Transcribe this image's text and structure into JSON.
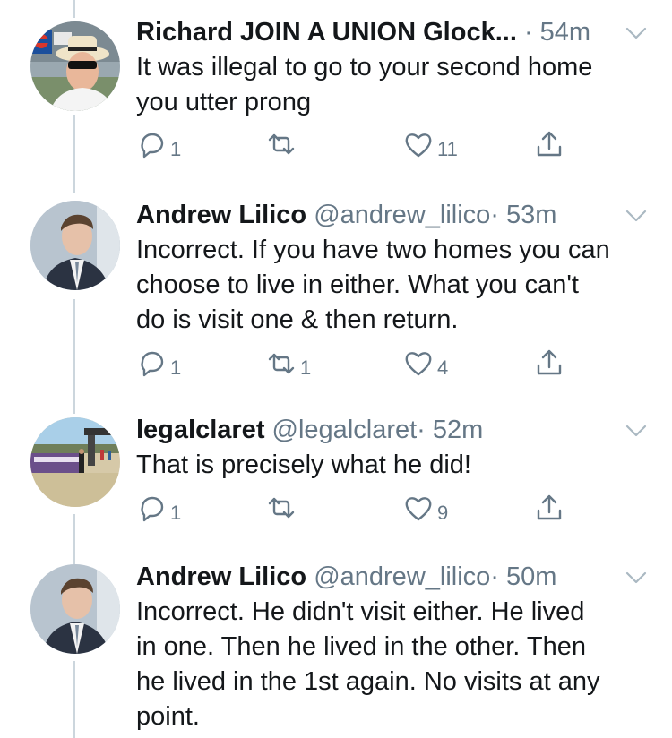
{
  "tweets": [
    {
      "name": "Richard JOIN A UNION Glock...",
      "handle": "",
      "time": "· 54m",
      "text_lines": [
        "It was illegal to go to your second home",
        "you utter prong"
      ],
      "replies": "1",
      "retweets": "",
      "likes": "11"
    },
    {
      "name": "Andrew Lilico",
      "handle": "@andrew_lilico",
      "time": "· 53m",
      "text_lines": [
        "Incorrect. If you have two homes you can",
        "choose to live in either. What you can't",
        "do is visit one & then return."
      ],
      "replies": "1",
      "retweets": "1",
      "likes": "4"
    },
    {
      "name": "legalclaret",
      "handle": "@legalclaret",
      "time": "· 52m",
      "text_lines": [
        "That is precisely what he did!"
      ],
      "replies": "1",
      "retweets": "",
      "likes": "9"
    },
    {
      "name": "Andrew Lilico",
      "handle": "@andrew_lilico",
      "time": "· 50m",
      "text_lines": [
        "Incorrect. He didn't visit either. He lived",
        "in one. Then he lived in the other. Then",
        "he lived in the 1st again. No visits at any",
        "point."
      ],
      "replies": "",
      "retweets": "",
      "likes": ""
    }
  ],
  "icons": {
    "reply": "reply-icon",
    "retweet": "retweet-icon",
    "like": "heart-icon",
    "share": "share-icon",
    "caret": "chevron-down-icon"
  },
  "colors": {
    "text": "#14171a",
    "secondary": "#657786",
    "thread_line": "#ccd6dd"
  }
}
